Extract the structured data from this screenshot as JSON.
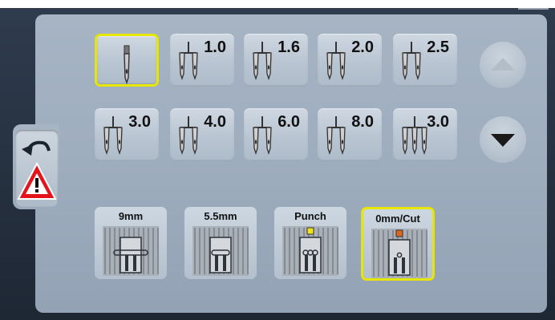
{
  "needles": [
    {
      "name": "single-needle",
      "label": "",
      "selected": true
    },
    {
      "name": "twin-needle-1-0",
      "label": "1.0",
      "selected": false
    },
    {
      "name": "twin-needle-1-6",
      "label": "1.6",
      "selected": false
    },
    {
      "name": "twin-needle-2-0",
      "label": "2.0",
      "selected": false
    },
    {
      "name": "twin-needle-2-5",
      "label": "2.5",
      "selected": false
    },
    {
      "name": "twin-needle-3-0",
      "label": "3.0",
      "selected": false
    },
    {
      "name": "twin-needle-4-0",
      "label": "4.0",
      "selected": false
    },
    {
      "name": "twin-needle-6-0",
      "label": "6.0",
      "selected": false
    },
    {
      "name": "twin-needle-8-0",
      "label": "8.0",
      "selected": false
    },
    {
      "name": "triple-needle-3-0",
      "label": "3.0",
      "selected": false
    }
  ],
  "plates": [
    {
      "label": "9mm",
      "selected": false
    },
    {
      "label": "5.5mm",
      "selected": false
    },
    {
      "label": "Punch",
      "selected": false,
      "marker": "#f2e21a"
    },
    {
      "label": "0mm/Cut",
      "selected": true,
      "marker": "#e0651c"
    }
  ],
  "scroll": {
    "up_icon": "triangle-up-icon",
    "down_icon": "triangle-down-icon",
    "up_enabled": false,
    "down_enabled": true
  },
  "colors": {
    "selection": "#e6e600",
    "warning": "#e3141b",
    "up_arrow": "#b3bec9",
    "down_arrow": "#1a1a1a"
  }
}
